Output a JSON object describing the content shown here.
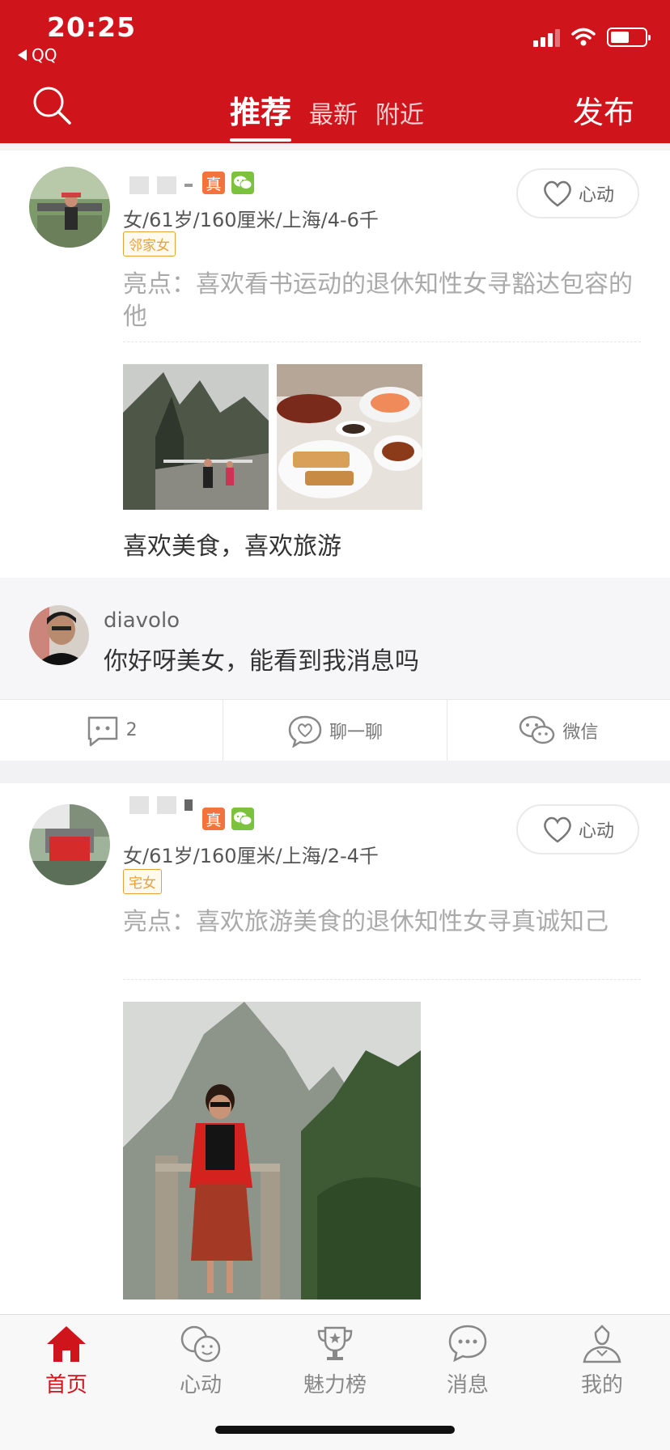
{
  "status_bar": {
    "time": "20:25",
    "back_app": "QQ"
  },
  "header": {
    "tabs": [
      {
        "label": "推荐",
        "active": true
      },
      {
        "label": "最新",
        "active": false
      },
      {
        "label": "附近",
        "active": false
      }
    ],
    "publish_label": "发布"
  },
  "posts": [
    {
      "badges": [
        "真",
        "wechat"
      ],
      "info": "女/61岁/160厘米/上海/4-6千",
      "tag": "邻家女",
      "highlight": "亮点：喜欢看书运动的退休知性女寻豁达包容的他",
      "heart_label": "心动",
      "caption": "喜欢美食，喜欢旅游",
      "comment": {
        "user": "diavolo",
        "text": "你好呀美女，能看到我消息吗"
      },
      "actions": {
        "comment_count": "2",
        "chat_label": "聊一聊",
        "wechat_label": "微信"
      }
    },
    {
      "badges": [
        "真",
        "wechat"
      ],
      "info": "女/61岁/160厘米/上海/2-4千",
      "tag": "宅女",
      "highlight": "亮点：喜欢旅游美食的退休知性女寻真诚知己",
      "heart_label": "心动"
    }
  ],
  "bottom_nav": [
    {
      "label": "首页",
      "icon": "home-icon",
      "active": true
    },
    {
      "label": "心动",
      "icon": "faces-icon",
      "active": false
    },
    {
      "label": "魅力榜",
      "icon": "trophy-icon",
      "active": false
    },
    {
      "label": "消息",
      "icon": "message-icon",
      "active": false
    },
    {
      "label": "我的",
      "icon": "person-icon",
      "active": false
    }
  ],
  "colors": {
    "brand": "#d0141b",
    "tag": "#e8a23a",
    "real_badge": "#f4723b",
    "wechat_badge": "#7cc23c"
  }
}
